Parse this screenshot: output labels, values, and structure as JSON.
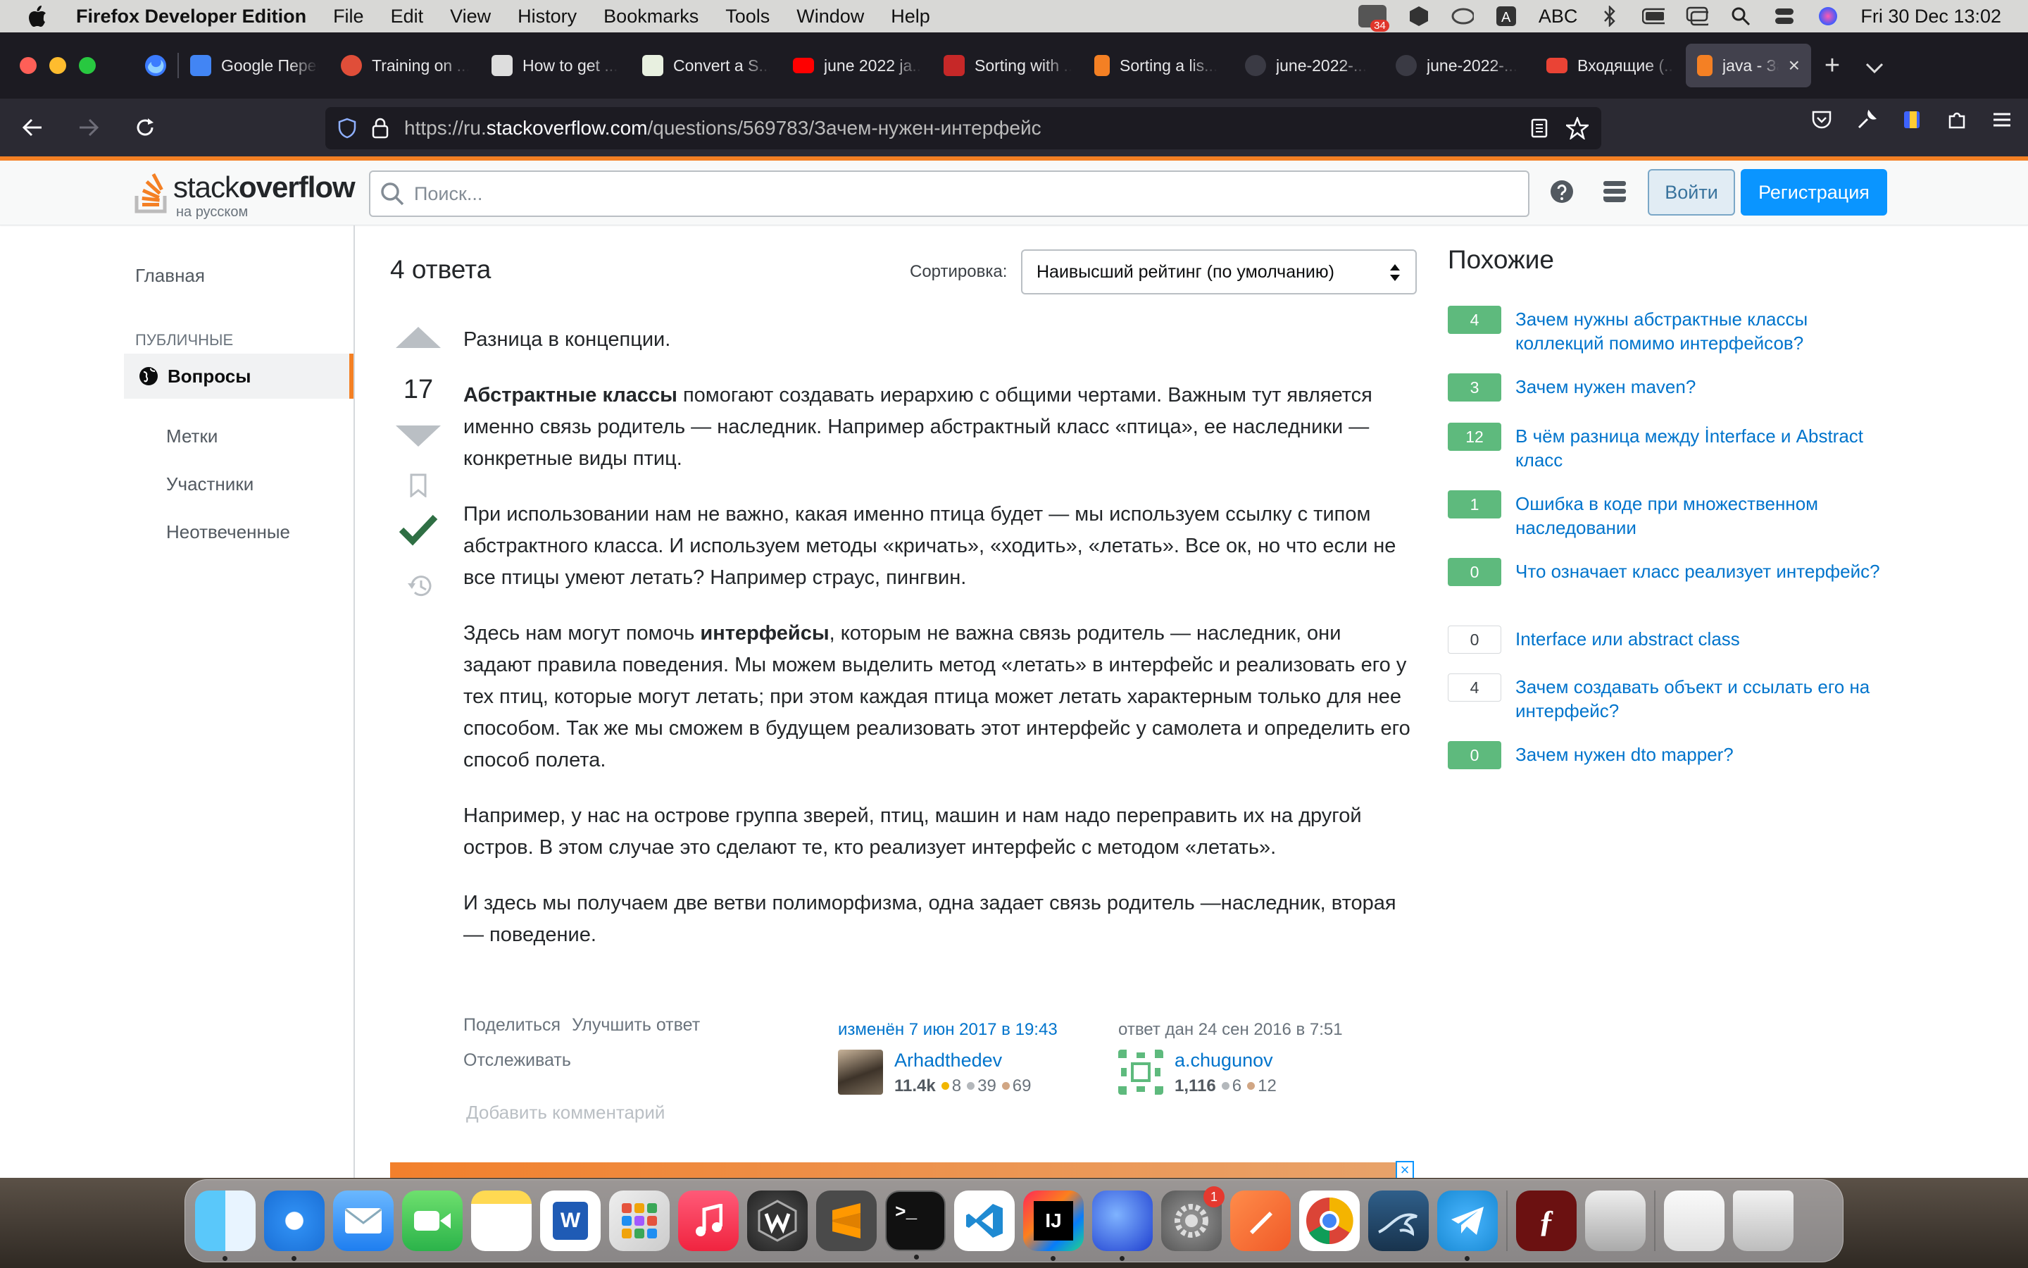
{
  "menubar": {
    "app": "Firefox Developer Edition",
    "items": [
      "File",
      "Edit",
      "View",
      "History",
      "Bookmarks",
      "Tools",
      "Window",
      "Help"
    ],
    "badge": "34",
    "input_source": "ABC",
    "datetime": "Fri 30 Dec  13:02"
  },
  "tabs": [
    {
      "label": "Google Переводчик",
      "color": "#4285f4"
    },
    {
      "label": "Training on ...",
      "color": "#e04e39"
    },
    {
      "label": "How to get ...",
      "color": "#555555"
    },
    {
      "label": "Convert a S...",
      "color": "#2e7d32"
    },
    {
      "label": "june 2022 ja...",
      "color": "#ff0000"
    },
    {
      "label": "Sorting with ...",
      "color": "#c62828"
    },
    {
      "label": "Sorting a lis...",
      "color": "#f48024"
    },
    {
      "label": "june-2022-...",
      "color": "#6e7681"
    },
    {
      "label": "june-2022-...",
      "color": "#6e7681"
    },
    {
      "label": "Входящие (...",
      "color": "#ea4335"
    },
    {
      "label": "java - Зачем нужен интерфейс",
      "color": "#f48024"
    }
  ],
  "urlbar": {
    "prefix": "https://ru.",
    "domain": "stackoverflow.com",
    "path": "/questions/569783/Зачем-нужен-интерфейс"
  },
  "so": {
    "logo_main": "stack",
    "logo_bold": "overflow",
    "logo_sub": "на русском",
    "search_placeholder": "Поиск...",
    "login": "Войти",
    "register": "Регистрация"
  },
  "leftnav": {
    "home": "Главная",
    "public": "ПУБЛИЧНЫЕ",
    "questions": "Вопросы",
    "tags": "Метки",
    "users": "Участники",
    "unanswered": "Неотвеченные"
  },
  "answers": {
    "header": "4 ответа",
    "sort_label": "Сортировка:",
    "sort_value": "Наивысший рейтинг (по умолчанию)",
    "score": "17"
  },
  "answer_body": {
    "p1": "Разница в концепции.",
    "p2_bold": "Абстрактные классы",
    "p2_rest": " помогают создавать иерархию с общими чертами. Важным тут является именно связь родитель — наследник. Например абстрактный класс «птица», ее наследники — конкретные виды птиц.",
    "p3": "При использовании нам не важно, какая именно птица будет — мы используем ссылку с типом абстрактного класса. И используем методы «кричать», «ходить», «летать». Все ок, но что если не все птицы умеют летать? Например страус, пингвин.",
    "p4_pre": "Здесь нам могут помочь ",
    "p4_bold": "интерфейсы",
    "p4_rest": ", которым не важна связь родитель — наследник, они задают правила поведения. Мы можем выделить метод «летать» в интерфейс и реализовать его у тех птиц, которые могут летать; при этом каждая птица может летать характерным только для нее способом. Так же мы сможем в будущем реализовать этот интерфейс у самолета и определить его способ полета.",
    "p5": "Например, у нас на острове группа зверей, птиц, машин и нам надо переправить их на другой остров. В этом случае это сделают те, кто реализует интерфейс с методом «летать».",
    "p6": "И здесь мы получаем две ветви полиморфизма, одна задает связь родитель —наследник, вторая — поведение."
  },
  "post_menu": {
    "share": "Поделиться",
    "improve": "Улучшить ответ",
    "follow": "Отслеживать"
  },
  "editor": {
    "action": "изменён 7 июн 2017 в 19:43",
    "name": "Arhadthedev",
    "rep": "11.4k",
    "gold": "8",
    "silver": "39",
    "bronze": "69"
  },
  "author": {
    "action": "ответ дан 24 сен 2016 в 7:51",
    "name": "a.chugunov",
    "rep": "1,116",
    "silver": "6",
    "bronze": "12"
  },
  "add_comment": "Добавить комментарий",
  "related": {
    "title": "Похожие",
    "items": [
      {
        "count": "4",
        "q": "Зачем нужны абстрактные классы коллекций помимо интерфейсов?"
      },
      {
        "count": "3",
        "q": "Зачем нужен maven?"
      },
      {
        "count": "12",
        "q": "В чём разница между İnterface и Abstract класс"
      },
      {
        "count": "1",
        "q": "Ошибка в коде при множественном наследовании"
      },
      {
        "count": "0",
        "q": "Что означает класс реализует интерфейс?"
      },
      {
        "count": "0",
        "q": "Interface или abstract class"
      },
      {
        "count": "4",
        "q": "Зачем создавать объект и ссылать его на интерфейс?"
      },
      {
        "count": "0",
        "q": "Зачем нужен dto mapper?"
      }
    ]
  },
  "dock": {
    "notification_badge": "1",
    "word_letter": "W",
    "intellij_letters": "IJ"
  }
}
